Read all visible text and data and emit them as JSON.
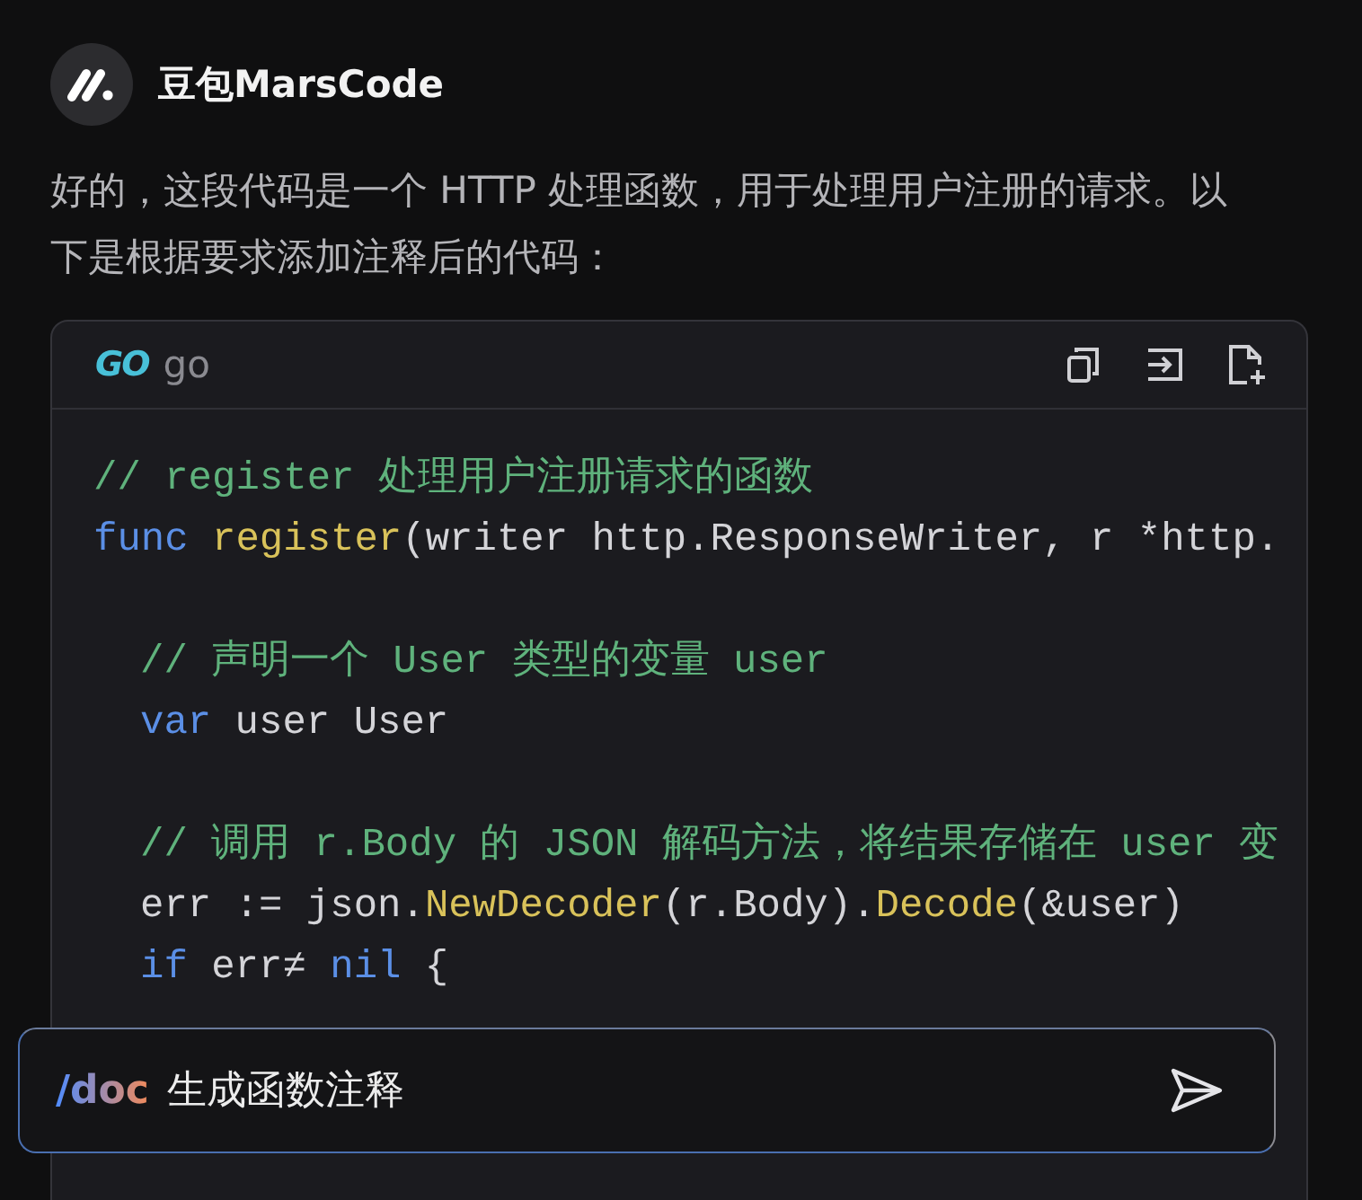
{
  "assistant": {
    "name": "豆包MarsCode"
  },
  "message": "好的，这段代码是一个 HTTP 处理函数，用于处理用户注册的请求。以下是根据要求添加注释后的代码：",
  "code_block": {
    "logo": "GO",
    "language": "go",
    "lines": [
      {
        "kind": "code",
        "indented": false,
        "tokens": [
          {
            "kind": "comment",
            "text": "// register 处理用户注册请求的函数"
          }
        ]
      },
      {
        "kind": "code",
        "indented": false,
        "tokens": [
          {
            "kind": "keyword",
            "text": "func "
          },
          {
            "kind": "function",
            "text": "register"
          },
          {
            "kind": "plain",
            "text": "(writer http.ResponseWriter, r *http."
          }
        ]
      },
      {
        "kind": "blank"
      },
      {
        "kind": "code",
        "indented": true,
        "tokens": [
          {
            "kind": "comment",
            "text": "// 声明一个 User 类型的变量 user"
          }
        ]
      },
      {
        "kind": "code",
        "indented": true,
        "tokens": [
          {
            "kind": "keyword",
            "text": "var"
          },
          {
            "kind": "plain",
            "text": " user User"
          }
        ]
      },
      {
        "kind": "blank"
      },
      {
        "kind": "code",
        "indented": true,
        "tokens": [
          {
            "kind": "comment",
            "text": "// 调用 r.Body 的 JSON 解码方法，将结果存储在 user 变"
          }
        ]
      },
      {
        "kind": "code",
        "indented": true,
        "tokens": [
          {
            "kind": "plain",
            "text": "err := json."
          },
          {
            "kind": "function",
            "text": "NewDecoder"
          },
          {
            "kind": "plain",
            "text": "(r.Body)."
          },
          {
            "kind": "function",
            "text": "Decode"
          },
          {
            "kind": "plain",
            "text": "(&user)"
          }
        ]
      },
      {
        "kind": "code",
        "indented": true,
        "tokens": [
          {
            "kind": "keyword",
            "text": "if"
          },
          {
            "kind": "plain",
            "text": " err≠ "
          },
          {
            "kind": "keyword",
            "text": "nil"
          },
          {
            "kind": "plain",
            "text": " {"
          }
        ]
      }
    ]
  },
  "input": {
    "command": "/doc",
    "value": "生成函数注释"
  }
}
